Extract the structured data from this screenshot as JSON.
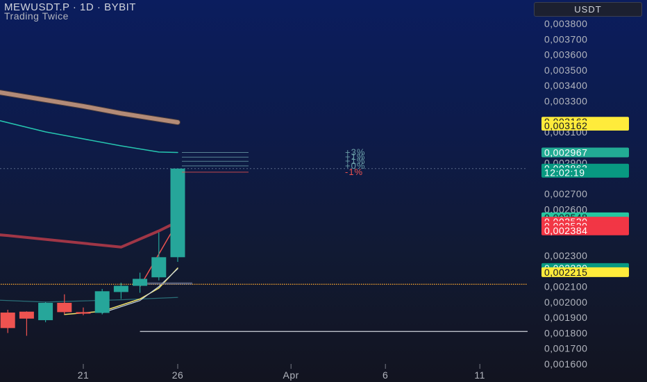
{
  "header": {
    "title": "MEWUSDT.P · 1D · BYBIT",
    "subtitle": "Trading Twice",
    "currency_button": "USDT"
  },
  "colors": {
    "up": "#26a69a",
    "down": "#ef5350",
    "yellow_tag": "#ffeb3b",
    "teal_tag": "#22ab94"
  },
  "chart_data": {
    "type": "candlestick",
    "title": "MEWUSDT.P · 1D · BYBIT",
    "x_ticks": [
      "21",
      "26",
      "Apr",
      "6",
      "11"
    ],
    "y_ticks": [
      "0,001600",
      "0,001700",
      "0,001800",
      "0,001900",
      "0,002000",
      "0,002100",
      "0,002300",
      "0,002600",
      "0,002700",
      "0,002900",
      "0,003100",
      "0,003300",
      "0,003400",
      "0,003500",
      "0,003600",
      "0,003700",
      "0,003800"
    ],
    "ylim": [
      0.00155,
      0.00385
    ],
    "grid": false,
    "candles": [
      {
        "date": "Mar 17",
        "open": 0.001932,
        "high": 0.00195,
        "low": 0.0018,
        "close": 0.001832
      },
      {
        "date": "Mar 18",
        "open": 0.001938,
        "high": 0.00194,
        "low": 0.001782,
        "close": 0.001893
      },
      {
        "date": "Mar 19",
        "open": 0.001883,
        "high": 0.002,
        "low": 0.00187,
        "close": 0.001995
      },
      {
        "date": "Mar 20",
        "open": 0.001995,
        "high": 0.00205,
        "low": 0.00192,
        "close": 0.001935
      },
      {
        "date": "Mar 21",
        "open": 0.001935,
        "high": 0.001965,
        "low": 0.001915,
        "close": 0.001925
      },
      {
        "date": "Mar 22",
        "open": 0.00193,
        "high": 0.002085,
        "low": 0.00192,
        "close": 0.00207
      },
      {
        "date": "Mar 23",
        "open": 0.002065,
        "high": 0.002125,
        "low": 0.00202,
        "close": 0.002105
      },
      {
        "date": "Mar 24",
        "open": 0.002105,
        "high": 0.00219,
        "low": 0.00206,
        "close": 0.00215
      },
      {
        "date": "Mar 25",
        "open": 0.00216,
        "high": 0.00245,
        "low": 0.00214,
        "close": 0.00229
      },
      {
        "date": "Mar 26",
        "open": 0.00229,
        "high": 0.002863,
        "low": 0.00226,
        "close": 0.002863
      }
    ],
    "series": [
      {
        "values": [
          {
            "date": "Mar 11",
            "y": 0.003441
          },
          {
            "date": "Mar 16",
            "y": 0.003367
          },
          {
            "date": "Mar 21",
            "y": 0.003266
          },
          {
            "date": "Mar 23",
            "y": 0.00322
          },
          {
            "date": "Mar 26",
            "y": 0.003162
          }
        ]
      },
      {
        "values": [
          {
            "date": "Mar 11",
            "y": 0.003326
          },
          {
            "date": "Mar 15",
            "y": 0.00322
          },
          {
            "date": "Mar 19",
            "y": 0.0031
          },
          {
            "date": "Mar 23",
            "y": 0.00301
          },
          {
            "date": "Mar 25",
            "y": 0.00297
          },
          {
            "date": "Mar 26",
            "y": 0.002967
          }
        ]
      },
      {
        "values": [
          {
            "date": "Mar 11",
            "y": 0.00249
          },
          {
            "date": "Mar 17",
            "y": 0.00243
          },
          {
            "date": "Mar 23",
            "y": 0.002355
          },
          {
            "date": "Mar 25",
            "y": 0.00246
          },
          {
            "date": "Mar 26",
            "y": 0.00252
          }
        ]
      },
      {
        "values": [
          {
            "date": "Mar 11",
            "y": 0.00205
          },
          {
            "date": "Mar 15",
            "y": 0.00202
          },
          {
            "date": "Mar 19",
            "y": 0.002
          },
          {
            "date": "Mar 23",
            "y": 0.002015
          },
          {
            "date": "Mar 26",
            "y": 0.00203
          }
        ]
      },
      {
        "values": [
          {
            "date": "Mar 20",
            "y": 0.00192
          },
          {
            "date": "Mar 22",
            "y": 0.00194
          },
          {
            "date": "Mar 24",
            "y": 0.00202
          },
          {
            "date": "Mar 25",
            "y": 0.00209
          },
          {
            "date": "Mar 26",
            "y": 0.00222
          }
        ]
      },
      {
        "values": [
          {
            "date": "Mar 22",
            "y": 0.00193
          },
          {
            "date": "Mar 24",
            "y": 0.00201
          },
          {
            "date": "Mar 25",
            "y": 0.0021
          },
          {
            "date": "Mar 26",
            "y": 0.002215
          }
        ]
      },
      {
        "values": [
          {
            "date": "Mar 24",
            "y": 0.0021
          },
          {
            "date": "Mar 26",
            "y": 0.00252
          }
        ]
      }
    ],
    "levels": [
      {
        "label": "+3%",
        "value": 0.002967,
        "color": "#6b9fa8"
      },
      {
        "label": "+1%",
        "value": 0.002937,
        "color": "#6b9fa8"
      },
      {
        "label": "+1%",
        "value": 0.00291,
        "color": "#6b9fa8"
      },
      {
        "label": "+0%",
        "value": 0.00288,
        "color": "#6b9fa8"
      },
      {
        "label": "-1%",
        "value": 0.00284,
        "color": "#ef5350"
      }
    ],
    "hlines": [
      {
        "value": 0.002115,
        "color": "#f0a030",
        "style": "dotted",
        "from_date": "Mar 11"
      },
      {
        "value": 0.00181,
        "color": "#d1d4dc",
        "style": "solid",
        "from_date": "Mar 24"
      },
      {
        "value": 0.00212,
        "color": "#7a86a8",
        "style": "solid",
        "from_date": "Mar 24"
      }
    ],
    "price_tags": [
      {
        "text": "0,003162",
        "value": 0.003166,
        "bg": "#ffeb3b",
        "fg": "#131722"
      },
      {
        "text": "0,003162",
        "value": 0.00314,
        "bg": "#ffeb3b",
        "fg": "#131722"
      },
      {
        "text": "0,002967",
        "value": 0.002967,
        "bg": "#22ab94",
        "fg": "#ffffff"
      },
      {
        "text": "0,002863",
        "value": 0.002863,
        "bg": "#089981",
        "fg": "#ffffff"
      },
      {
        "text": "12:02:19",
        "value": 0.002836,
        "bg": "#089981",
        "fg": "#ffffff"
      },
      {
        "text": "0,002548",
        "value": 0.002548,
        "bg": "#26c6a0",
        "fg": "#131722"
      },
      {
        "text": "0,002520",
        "value": 0.00252,
        "bg": "#f23645",
        "fg": "#ffffff"
      },
      {
        "text": "0,002520",
        "value": 0.002492,
        "bg": "#f23645",
        "fg": "#ffffff"
      },
      {
        "text": "0,002384",
        "value": 0.002463,
        "bg": "#f23645",
        "fg": "#ffffff"
      },
      {
        "text": "0,002220",
        "value": 0.00222,
        "bg": "#089981",
        "fg": "#ffffff"
      },
      {
        "text": "0,002215",
        "value": 0.002193,
        "bg": "#ffeb3b",
        "fg": "#131722"
      }
    ]
  }
}
